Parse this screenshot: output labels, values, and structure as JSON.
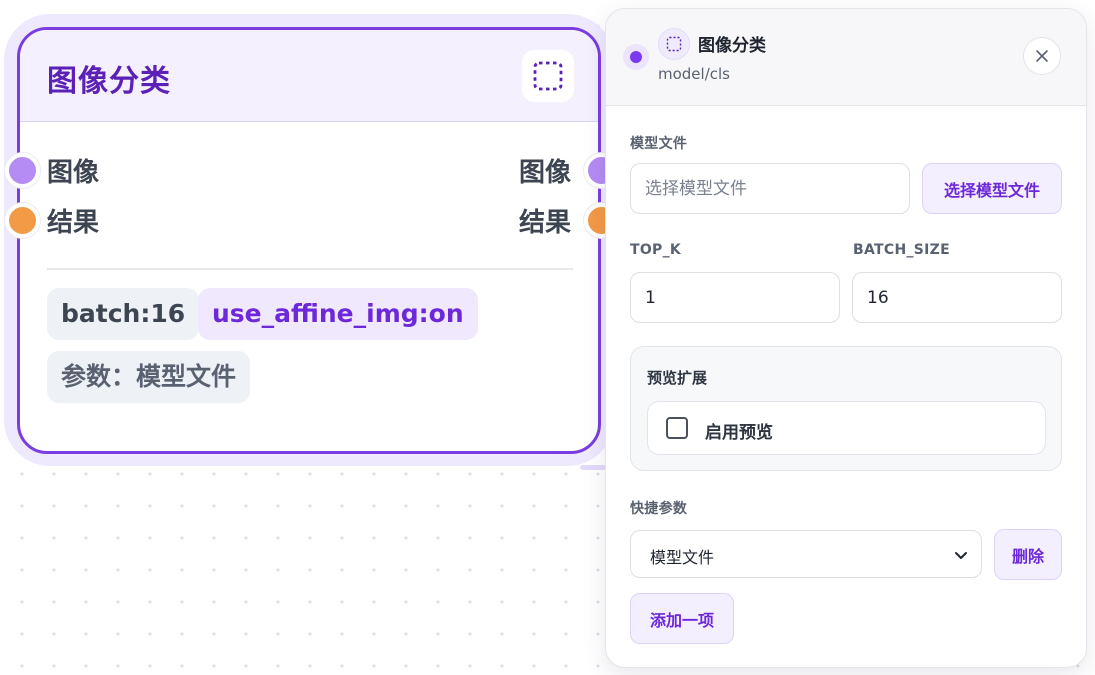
{
  "node": {
    "title": "图像分类",
    "inputs": [
      {
        "label": "图像",
        "color": "#b48cf3"
      },
      {
        "label": "结果",
        "color": "#f39a46"
      }
    ],
    "outputs": [
      {
        "label": "图像",
        "color": "#b48cf3"
      },
      {
        "label": "结果",
        "color": "#f39a46"
      }
    ],
    "chips": [
      {
        "text": "batch:16"
      },
      {
        "text": "use_affine_img:on"
      },
      {
        "text": "参数：模型文件"
      }
    ],
    "accent_color": "#7a3ee0",
    "icon": "dashed-square-icon"
  },
  "panel": {
    "title": "图像分类",
    "subtitle": "model/cls",
    "icon": "dashed-square-icon",
    "close_icon": "close-icon",
    "model_file": {
      "label": "模型文件",
      "placeholder": "选择模型文件",
      "value": "",
      "button_label": "选择模型文件"
    },
    "top_k": {
      "label": "TOP_K",
      "value": "1"
    },
    "batch_size": {
      "label": "BATCH_SIZE",
      "value": "16"
    },
    "preview": {
      "title": "预览扩展",
      "checkbox_label": "启用预览",
      "checked": false
    },
    "quick_params": {
      "label": "快捷参数",
      "selected": "模型文件",
      "delete_label": "删除",
      "add_label": "添加一项"
    },
    "accent_color": "#6d28d9"
  }
}
